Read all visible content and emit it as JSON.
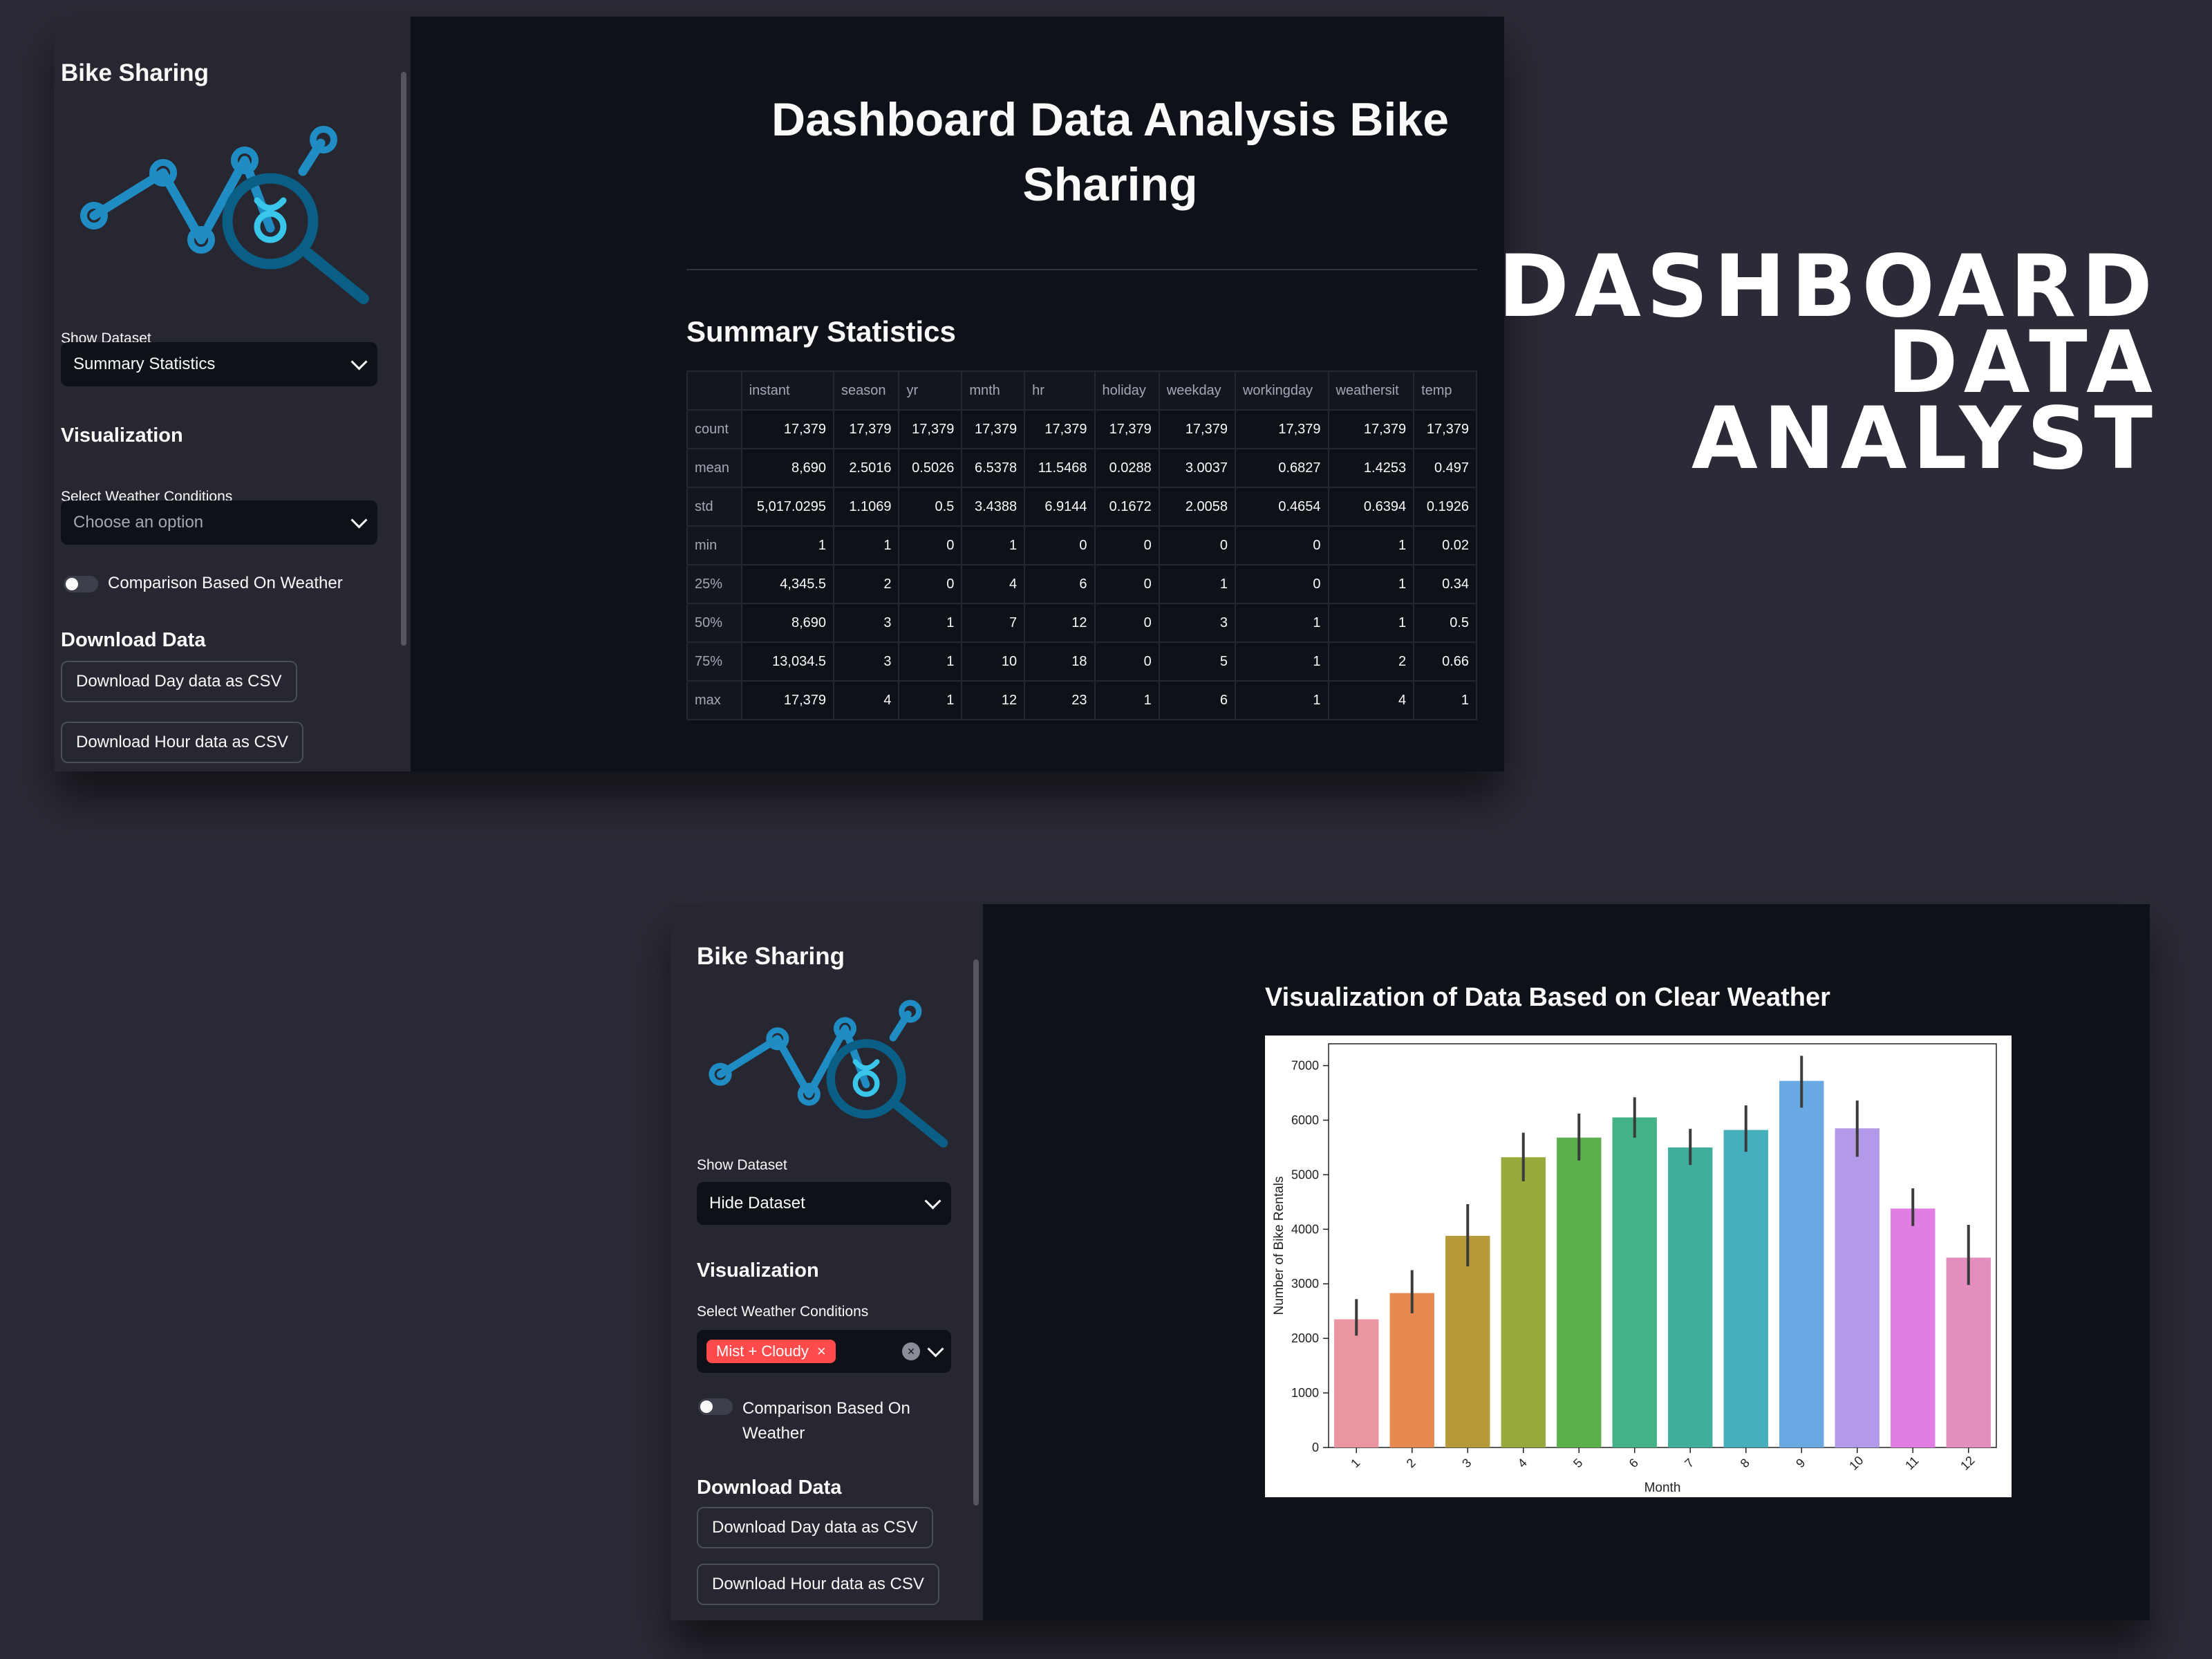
{
  "app": {
    "title": "Bike Sharing"
  },
  "sidebar": {
    "show_dataset_label": "Show Dataset",
    "visualization_heading": "Visualization",
    "weather_label": "Select Weather Conditions",
    "download_heading": "Download Data",
    "download_day_label": "Download Day data as CSV",
    "download_hour_label": "Download Hour data as CSV"
  },
  "top_panel": {
    "show_dataset_value": "Summary Statistics",
    "weather_placeholder": "Choose an option",
    "comparison_toggle_label": "Comparison Based On Weather",
    "page_title": "Dashboard Data Analysis Bike Sharing",
    "section_title": "Summary Statistics",
    "table": {
      "columns": [
        "",
        "instant",
        "season",
        "yr",
        "mnth",
        "hr",
        "holiday",
        "weekday",
        "workingday",
        "weathersit",
        "temp"
      ],
      "rows": [
        [
          "count",
          "17,379",
          "17,379",
          "17,379",
          "17,379",
          "17,379",
          "17,379",
          "17,379",
          "17,379",
          "17,379",
          "17,379"
        ],
        [
          "mean",
          "8,690",
          "2.5016",
          "0.5026",
          "6.5378",
          "11.5468",
          "0.0288",
          "3.0037",
          "0.6827",
          "1.4253",
          "0.497"
        ],
        [
          "std",
          "5,017.0295",
          "1.1069",
          "0.5",
          "3.4388",
          "6.9144",
          "0.1672",
          "2.0058",
          "0.4654",
          "0.6394",
          "0.1926"
        ],
        [
          "min",
          "1",
          "1",
          "0",
          "1",
          "0",
          "0",
          "0",
          "0",
          "1",
          "0.02"
        ],
        [
          "25%",
          "4,345.5",
          "2",
          "0",
          "4",
          "6",
          "0",
          "1",
          "0",
          "1",
          "0.34"
        ],
        [
          "50%",
          "8,690",
          "3",
          "1",
          "7",
          "12",
          "0",
          "3",
          "1",
          "1",
          "0.5"
        ],
        [
          "75%",
          "13,034.5",
          "3",
          "1",
          "10",
          "18",
          "0",
          "5",
          "1",
          "2",
          "0.66"
        ],
        [
          "max",
          "17,379",
          "4",
          "1",
          "12",
          "23",
          "1",
          "6",
          "1",
          "4",
          "1"
        ]
      ]
    }
  },
  "bottom_panel": {
    "show_dataset_value": "Hide Dataset",
    "weather_chip": "Mist + Cloudy",
    "comparison_toggle_line1": "Comparison Based On",
    "comparison_toggle_line2": "Weather",
    "chart_heading": "Visualization of Data Based on Clear Weather"
  },
  "headline": {
    "line1": "DASHBOARD",
    "line2": "DATA",
    "line3": "ANALYST"
  },
  "icons": {
    "chevron": "chevron-down-icon",
    "chip_remove": "×",
    "clear": "×",
    "logo": "analytics-magnifier-logo"
  },
  "colors": {
    "background": "#2a2b36",
    "app_bg": "#0e1117",
    "sidebar_bg": "#262730",
    "accent_red": "#ff4b4b",
    "logo_light": "#1f8dc4",
    "logo_dark": "#0a5f86"
  },
  "chart_data": {
    "type": "bar",
    "xlabel": "Month",
    "ylabel": "Number of Bike Rentals",
    "ylim": [
      0,
      7400
    ],
    "yticks": [
      0,
      1000,
      2000,
      3000,
      4000,
      5000,
      6000,
      7000
    ],
    "categories": [
      "1",
      "2",
      "3",
      "4",
      "5",
      "6",
      "7",
      "8",
      "9",
      "10",
      "11",
      "12"
    ],
    "values": [
      2350,
      2830,
      3880,
      5320,
      5680,
      6050,
      5500,
      5820,
      6720,
      5850,
      4380,
      3480
    ],
    "error_low": [
      2050,
      2460,
      3320,
      4880,
      5260,
      5680,
      5180,
      5420,
      6230,
      5330,
      4060,
      2980
    ],
    "error_high": [
      2720,
      3250,
      4460,
      5770,
      6120,
      6420,
      5840,
      6270,
      7180,
      6360,
      4750,
      4080
    ],
    "colors": [
      "#ea95a2",
      "#e6894f",
      "#b69a3a",
      "#97a83d",
      "#5bb04d",
      "#44b287",
      "#3fae9b",
      "#46aebd",
      "#69a9e3",
      "#b29ae8",
      "#e07ee3",
      "#e48ec0"
    ]
  }
}
